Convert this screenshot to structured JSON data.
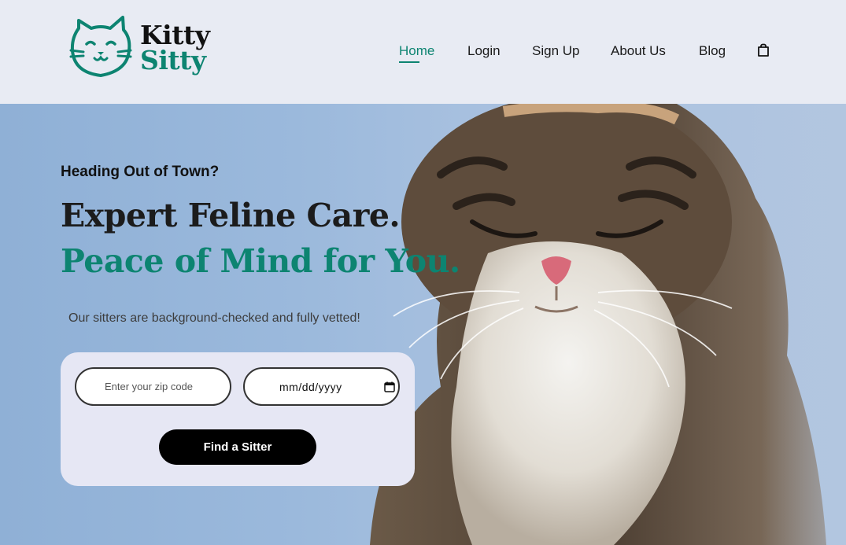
{
  "brand": {
    "name_line1": "Kitty",
    "name_line2": "Sitty",
    "accent_color": "#0d8471",
    "logo_icon": "cat-face-icon"
  },
  "nav": {
    "items": [
      {
        "label": "Home",
        "active": true
      },
      {
        "label": "Login",
        "active": false
      },
      {
        "label": "Sign Up",
        "active": false
      },
      {
        "label": "About Us",
        "active": false
      },
      {
        "label": "Blog",
        "active": false
      }
    ],
    "cart_icon": "shopping-bag-icon"
  },
  "hero": {
    "eyebrow": "Heading Out of Town?",
    "headline_line1": "Expert Feline Care.",
    "headline_line2": "Peace of Mind for You.",
    "subtext": "Our sitters are background-checked and fully vetted!",
    "background_image": "cat-photo"
  },
  "search_form": {
    "zip_placeholder": "Enter your zip code",
    "zip_value": "",
    "date_placeholder": "mm/dd/yyyy",
    "date_icon": "calendar-icon",
    "submit_label": "Find a Sitter"
  }
}
